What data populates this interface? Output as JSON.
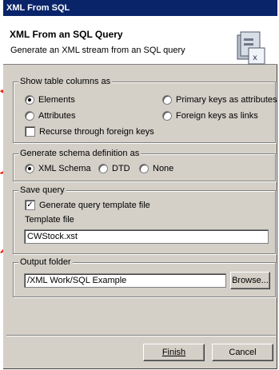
{
  "window": {
    "title": "XML From SQL"
  },
  "banner": {
    "title": "XML From an SQL Query",
    "description": "Generate an XML stream from an SQL query"
  },
  "table_columns": {
    "legend": "Show table columns as",
    "elements": "Elements",
    "primary_keys_as_attributes": "Primary keys as attributes",
    "attributes": "Attributes",
    "foreign_keys_as_links": "Foreign keys as links",
    "recurse_foreign_keys": "Recurse through foreign keys",
    "selected": "Elements"
  },
  "schema": {
    "legend": "Generate schema definition as",
    "xml_schema": "XML Schema",
    "dtd": "DTD",
    "none": "None",
    "selected": "XML Schema"
  },
  "save_query": {
    "legend": "Save query",
    "generate_template": "Generate query template file",
    "generate_template_checked": true,
    "template_file_label": "Template file",
    "template_file_value": "CWStock.xst"
  },
  "output": {
    "legend": "Output folder",
    "folder_value": "/XML Work/SQL Example",
    "browse_label": "Browse..."
  },
  "buttons": {
    "finish_label": "Finish",
    "cancel_label": "Cancel"
  },
  "colors": {
    "titlebar": "#0a246a",
    "dialog_bg": "#d4d0c8",
    "arrow": "#e8251a"
  }
}
